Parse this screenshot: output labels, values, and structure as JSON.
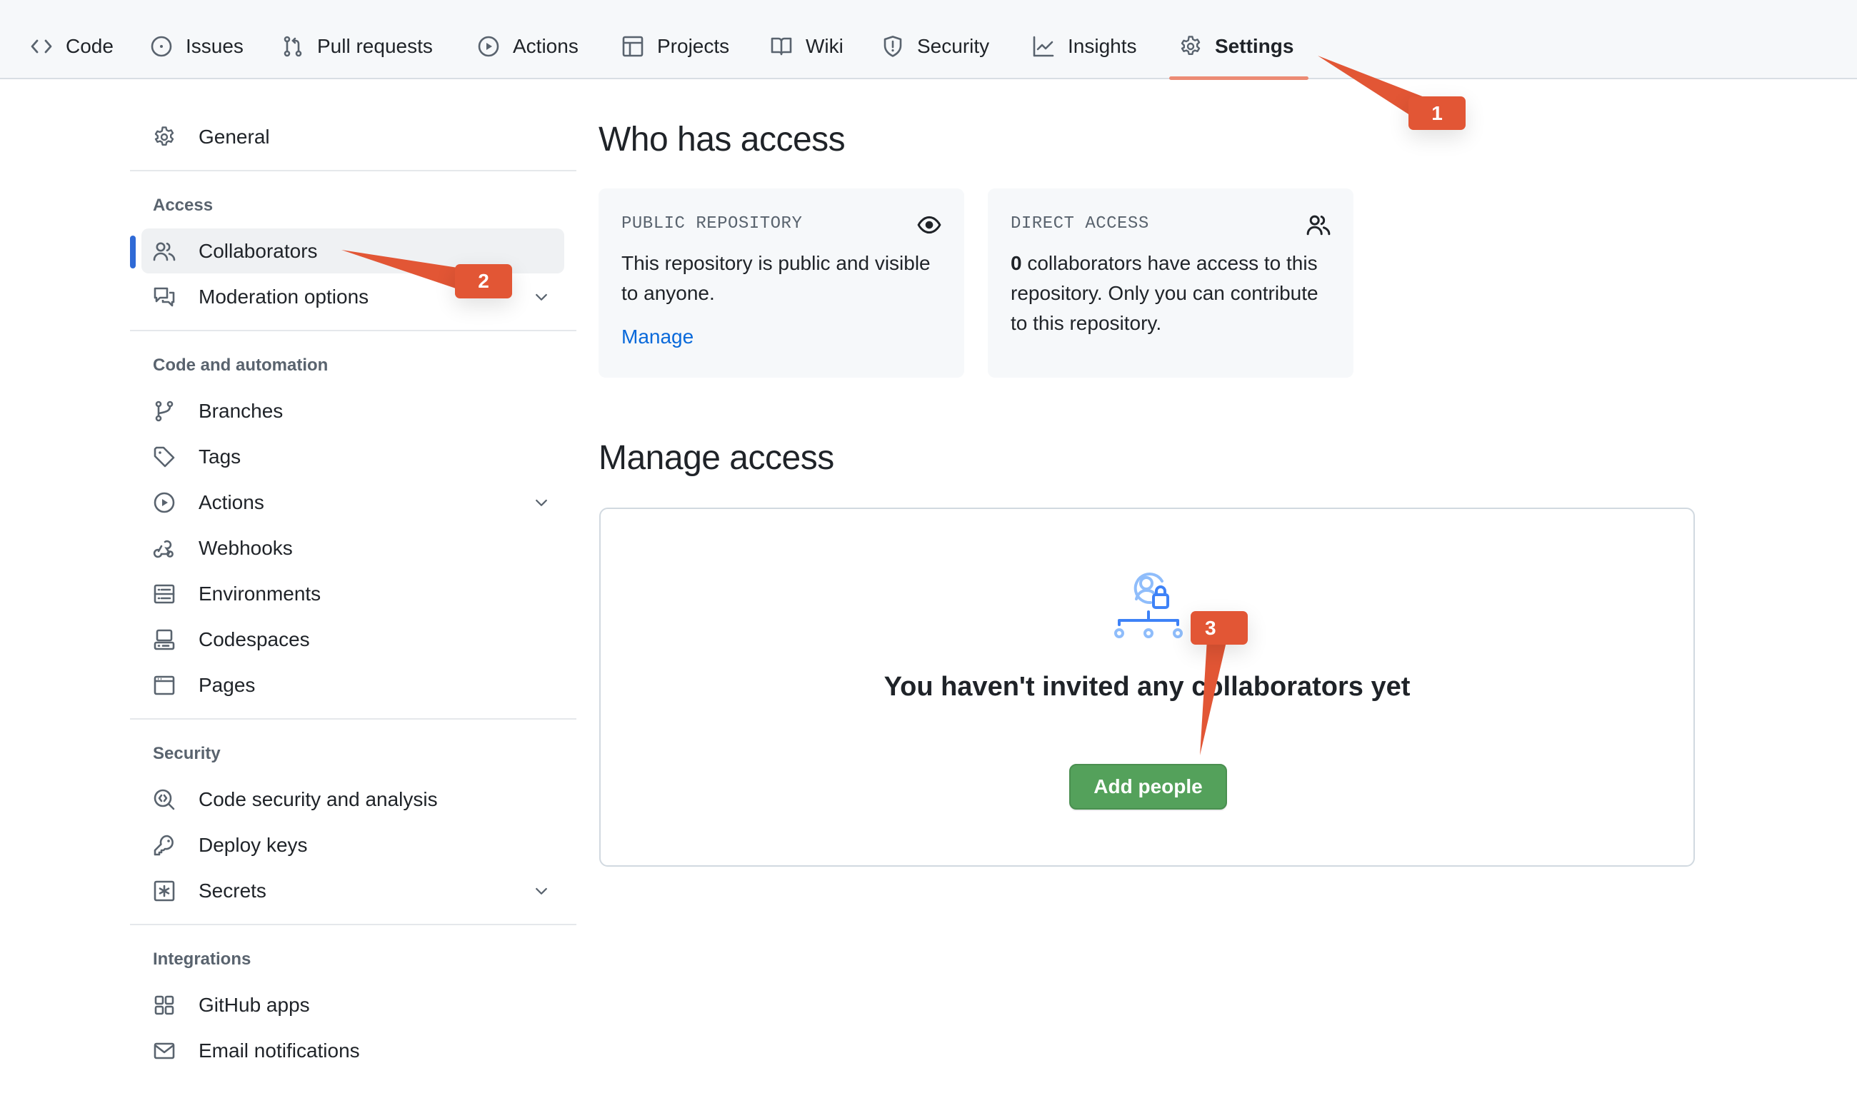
{
  "topnav": {
    "tabs": [
      {
        "label": "Code",
        "icon": "code-icon"
      },
      {
        "label": "Issues",
        "icon": "issue-opened-icon"
      },
      {
        "label": "Pull requests",
        "icon": "git-pull-request-icon"
      },
      {
        "label": "Actions",
        "icon": "play-icon"
      },
      {
        "label": "Projects",
        "icon": "table-icon"
      },
      {
        "label": "Wiki",
        "icon": "book-icon"
      },
      {
        "label": "Security",
        "icon": "shield-icon"
      },
      {
        "label": "Insights",
        "icon": "graph-icon"
      },
      {
        "label": "Settings",
        "icon": "gear-icon",
        "active": true
      }
    ],
    "active_color": "#ec8b74"
  },
  "sidebar": {
    "general": {
      "label": "General",
      "icon": "gear-icon"
    },
    "sections": [
      {
        "heading": "Access",
        "items": [
          {
            "label": "Collaborators",
            "icon": "people-icon",
            "selected": true
          },
          {
            "label": "Moderation options",
            "icon": "comment-discussion-icon",
            "expandable": true
          }
        ]
      },
      {
        "heading": "Code and automation",
        "items": [
          {
            "label": "Branches",
            "icon": "git-branch-icon"
          },
          {
            "label": "Tags",
            "icon": "tag-icon"
          },
          {
            "label": "Actions",
            "icon": "play-icon",
            "expandable": true
          },
          {
            "label": "Webhooks",
            "icon": "webhook-icon"
          },
          {
            "label": "Environments",
            "icon": "server-icon"
          },
          {
            "label": "Codespaces",
            "icon": "codespaces-icon"
          },
          {
            "label": "Pages",
            "icon": "browser-icon"
          }
        ]
      },
      {
        "heading": "Security",
        "items": [
          {
            "label": "Code security and analysis",
            "icon": "codescan-icon"
          },
          {
            "label": "Deploy keys",
            "icon": "key-icon"
          },
          {
            "label": "Secrets",
            "icon": "key-asterisk-icon",
            "expandable": true
          }
        ]
      },
      {
        "heading": "Integrations",
        "items": [
          {
            "label": "GitHub apps",
            "icon": "apps-icon"
          },
          {
            "label": "Email notifications",
            "icon": "mail-icon"
          }
        ]
      }
    ],
    "active_indicator_color": "#2f6ad6"
  },
  "main": {
    "who_title": "Who has access",
    "public_card": {
      "label": "PUBLIC REPOSITORY",
      "body": "This repository is public and visible to anyone.",
      "link": "Manage"
    },
    "direct_card": {
      "label": "DIRECT ACCESS",
      "count": "0",
      "body_rest": " collaborators have access to this repository. Only you can contribute to this repository."
    },
    "manage_title": "Manage access",
    "empty_state": {
      "title": "You haven't invited any collaborators yet",
      "button": "Add people",
      "button_color": "#54a15b"
    }
  },
  "annotations": [
    {
      "number": "1",
      "target": "Settings tab"
    },
    {
      "number": "2",
      "target": "Collaborators"
    },
    {
      "number": "3",
      "target": "Add people"
    }
  ],
  "annotation_color": "#e25635"
}
